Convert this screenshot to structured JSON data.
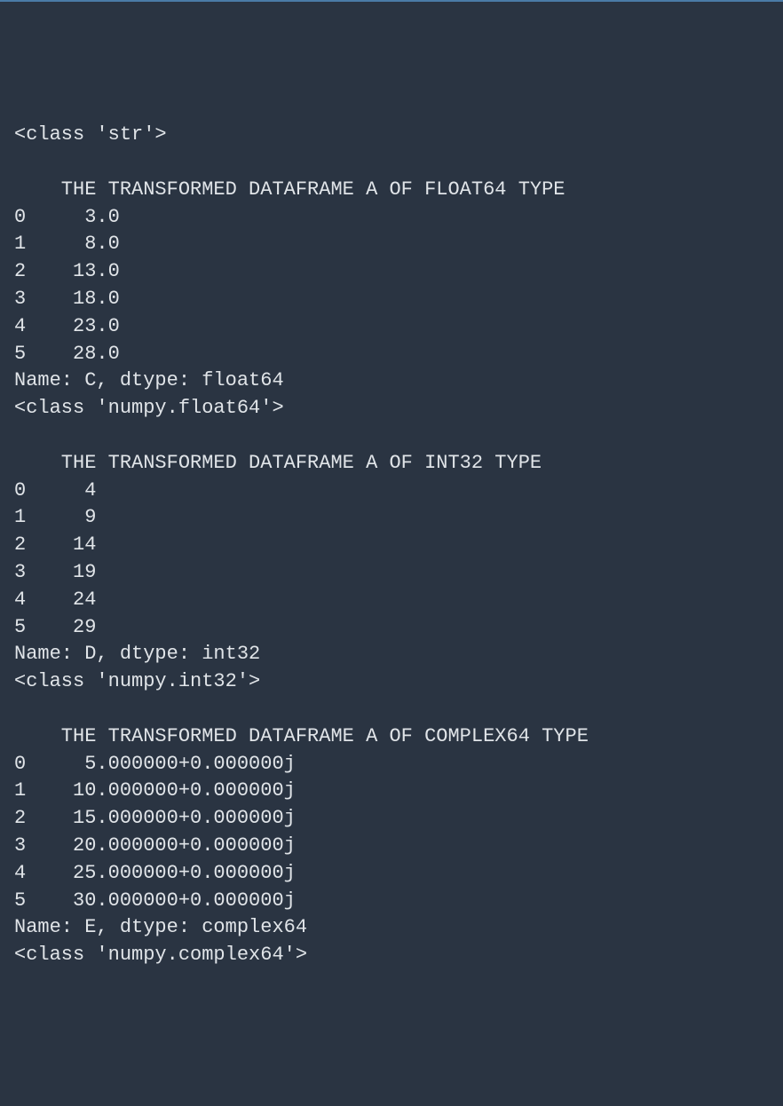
{
  "output": {
    "class_str": "<class 'str'>",
    "blank1": "",
    "section1": {
      "heading": "    THE TRANSFORMED DATAFRAME A OF FLOAT64 TYPE",
      "rows": [
        "0     3.0",
        "1     8.0",
        "2    13.0",
        "3    18.0",
        "4    23.0",
        "5    28.0"
      ],
      "name_line": "Name: C, dtype: float64",
      "class_line": "<class 'numpy.float64'>"
    },
    "blank2": "",
    "section2": {
      "heading": "    THE TRANSFORMED DATAFRAME A OF INT32 TYPE",
      "rows": [
        "0     4",
        "1     9",
        "2    14",
        "3    19",
        "4    24",
        "5    29"
      ],
      "name_line": "Name: D, dtype: int32",
      "class_line": "<class 'numpy.int32'>"
    },
    "blank3": "",
    "section3": {
      "heading": "    THE TRANSFORMED DATAFRAME A OF COMPLEX64 TYPE",
      "rows": [
        "0     5.000000+0.000000j",
        "1    10.000000+0.000000j",
        "2    15.000000+0.000000j",
        "3    20.000000+0.000000j",
        "4    25.000000+0.000000j",
        "5    30.000000+0.000000j"
      ],
      "name_line": "Name: E, dtype: complex64",
      "class_line": "<class 'numpy.complex64'>"
    }
  }
}
